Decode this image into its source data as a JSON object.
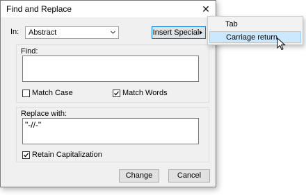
{
  "dialog": {
    "title": "Find and Replace",
    "close_glyph": "✕",
    "in_label": "In:",
    "in_value": "Abstract",
    "insert_special_label": "Insert Special",
    "find": {
      "label": "Find:",
      "value": ""
    },
    "match_case": {
      "label": "Match Case",
      "checked": false
    },
    "match_words": {
      "label": "Match Words",
      "checked": true
    },
    "replace": {
      "label": "Replace with:",
      "value": "\"-//-\""
    },
    "retain_capitalization": {
      "label": "Retain Capitalization",
      "checked": true
    },
    "change_label": "Change",
    "cancel_label": "Cancel"
  },
  "insert_special_menu": {
    "items": [
      {
        "label": "Tab",
        "highlighted": false
      },
      {
        "label": "Carriage return",
        "highlighted": true
      }
    ]
  },
  "colors": {
    "dialog_bg": "#f0f0f0",
    "menu_highlight": "#cce8ff",
    "focus_border": "#0078d7"
  }
}
